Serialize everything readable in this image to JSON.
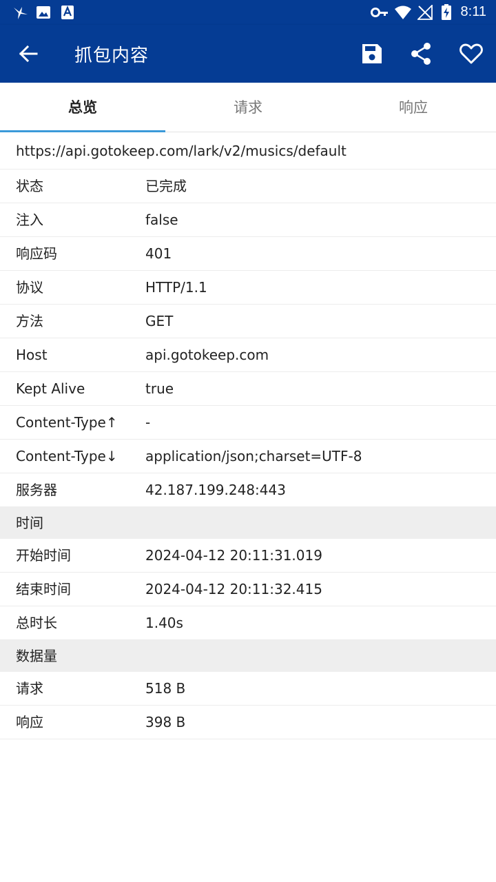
{
  "status_bar": {
    "time": "8:11",
    "left_icons": [
      "bird-icon",
      "image-icon",
      "font-icon"
    ],
    "right_icons": [
      "key-icon",
      "wifi-icon",
      "signal-icon",
      "battery-icon"
    ]
  },
  "app_bar": {
    "title": "抓包内容",
    "background": "#053c94",
    "actions": [
      "save-icon",
      "share-icon",
      "favorite-icon"
    ]
  },
  "tabs": [
    {
      "label": "总览",
      "active": true
    },
    {
      "label": "请求",
      "active": false
    },
    {
      "label": "响应",
      "active": false
    }
  ],
  "overview": {
    "url": "https://api.gotokeep.com/lark/v2/musics/default",
    "rows": [
      {
        "key": "状态",
        "value": "已完成"
      },
      {
        "key": "注入",
        "value": "false"
      },
      {
        "key": "响应码",
        "value": "401"
      },
      {
        "key": "协议",
        "value": "HTTP/1.1"
      },
      {
        "key": "方法",
        "value": "GET"
      },
      {
        "key": "Host",
        "value": "api.gotokeep.com"
      },
      {
        "key": "Kept Alive",
        "value": "true"
      },
      {
        "key": "Content-Type↑",
        "value": "-"
      },
      {
        "key": "Content-Type↓",
        "value": "application/json;charset=UTF-8"
      },
      {
        "key": "服务器",
        "value": "42.187.199.248:443"
      }
    ],
    "time_section": {
      "title": "时间",
      "rows": [
        {
          "key": "开始时间",
          "value": "2024-04-12 20:11:31.019"
        },
        {
          "key": "结束时间",
          "value": "2024-04-12 20:11:32.415"
        },
        {
          "key": "总时长",
          "value": "1.40s"
        }
      ]
    },
    "data_section": {
      "title": "数据量",
      "rows": [
        {
          "key": "请求",
          "value": "518 B"
        },
        {
          "key": "响应",
          "value": "398 B"
        }
      ]
    }
  }
}
